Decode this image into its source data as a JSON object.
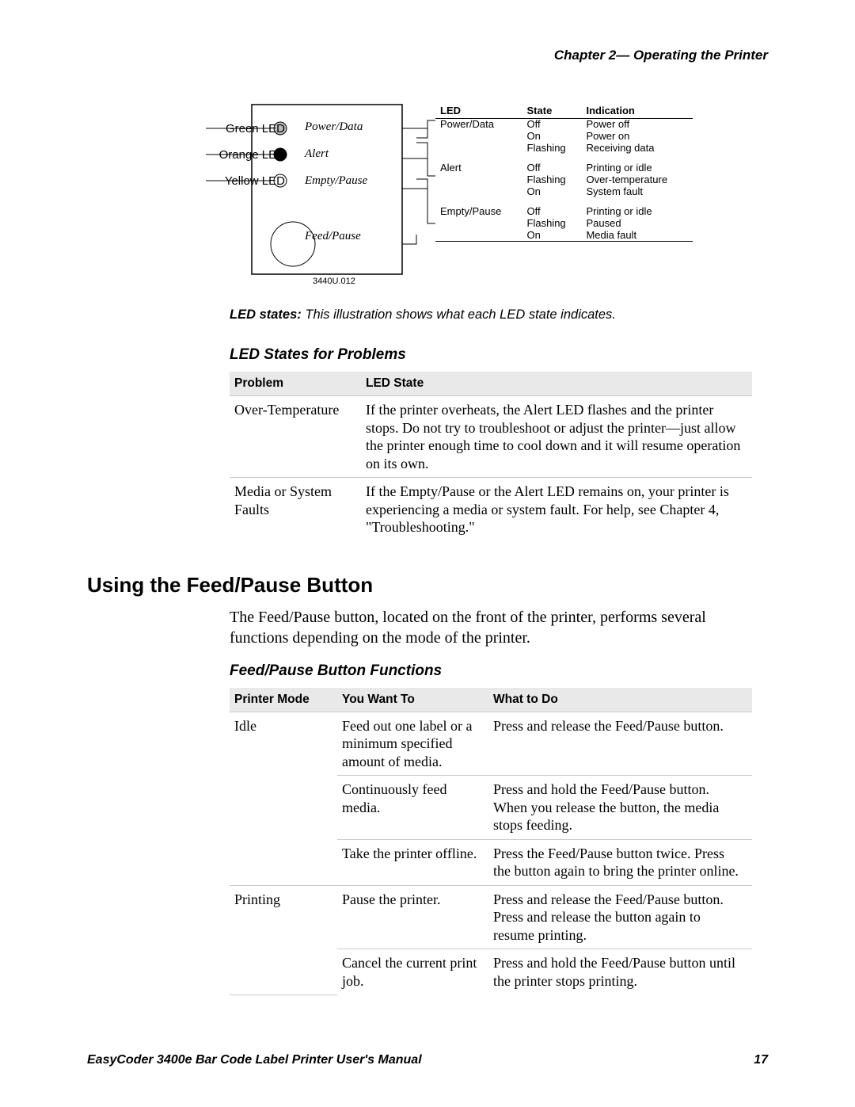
{
  "header": {
    "running_head": "Chapter 2— Operating the Printer"
  },
  "diagram": {
    "left_labels": {
      "green": "Green LED",
      "orange": "Orange LED",
      "yellow": "Yellow LED"
    },
    "panel_labels": {
      "power_data": "Power/Data",
      "alert": "Alert",
      "empty_pause": "Empty/Pause",
      "feed_pause": "Feed/Pause"
    },
    "part_number": "3440U.012",
    "table": {
      "col_led": "LED",
      "col_state": "State",
      "col_indication": "Indication",
      "rows": {
        "pd_led": "Power/Data",
        "pd_s0": "Off",
        "pd_i0": "Power off",
        "pd_s1": "On",
        "pd_i1": "Power on",
        "pd_s2": "Flashing",
        "pd_i2": "Receiving data",
        "al_led": "Alert",
        "al_s0": "Off",
        "al_i0": "Printing or idle",
        "al_s1": "Flashing",
        "al_i1": "Over-temperature",
        "al_s2": "On",
        "al_i2": "System fault",
        "ep_led": "Empty/Pause",
        "ep_s0": "Off",
        "ep_i0": "Printing or idle",
        "ep_s1": "Flashing",
        "ep_i1": "Paused",
        "ep_s2": "On",
        "ep_i2": "Media fault"
      }
    },
    "caption_strong": "LED states:",
    "caption_rest": " This illustration shows what each LED state indicates."
  },
  "problems_table": {
    "title": "LED States for Problems",
    "col1": "Problem",
    "col2": "LED State",
    "rows": {
      "r1c1": "Over-Temperature",
      "r1c2": "If the printer overheats, the Alert LED flashes and the printer stops. Do not try to troubleshoot or adjust the printer—just allow the printer enough time to cool down and it will resume operation on its own.",
      "r2c1": "Media or System Faults",
      "r2c2": "If the Empty/Pause or the Alert LED remains on, your printer is experiencing a media or system fault. For help, see Chapter 4, \"Troubleshooting.\""
    }
  },
  "feedpause": {
    "h2": "Using the Feed/Pause Button",
    "intro": "The Feed/Pause button, located on the front of the printer, performs several functions depending on the mode of the printer.",
    "title": "Feed/Pause Button Functions",
    "col1": "Printer Mode",
    "col2": "You Want To",
    "col3": "What to Do",
    "rows": {
      "r1_mode": "Idle",
      "r1_want": "Feed out one label or a minimum specified amount of media.",
      "r1_do": "Press and release the Feed/Pause button.",
      "r2_want": "Continuously feed media.",
      "r2_do": "Press and hold the Feed/Pause button. When you release the button, the media stops feeding.",
      "r3_want": "Take the printer offline.",
      "r3_do": "Press the Feed/Pause button twice. Press the button again to bring the printer online.",
      "r4_mode": "Printing",
      "r4_want": "Pause the printer.",
      "r4_do": "Press and release the Feed/Pause button. Press and release the button again to resume printing.",
      "r5_want": "Cancel the current print job.",
      "r5_do": "Press and hold the Feed/Pause button until the printer stops printing."
    }
  },
  "footer": {
    "manual": "EasyCoder 3400e Bar Code Label Printer User's Manual",
    "page": "17"
  }
}
